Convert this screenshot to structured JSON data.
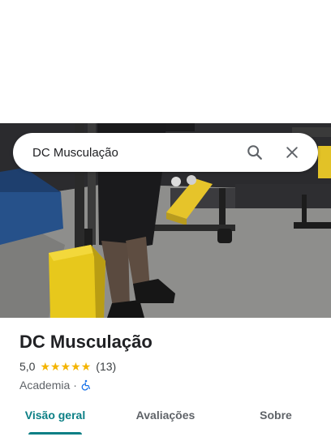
{
  "search": {
    "query": "DC Musculação",
    "search_icon": "search-icon",
    "close_icon": "close-icon"
  },
  "place": {
    "name": "DC Musculação",
    "rating": "5,0",
    "stars": 5,
    "reviews_count": "(13)",
    "category": "Academia",
    "separator": "·",
    "accessibility_icon": "wheelchair-icon"
  },
  "tabs": [
    {
      "label": "Visão geral",
      "active": true
    },
    {
      "label": "Avaliações",
      "active": false
    },
    {
      "label": "Sobre",
      "active": false
    }
  ],
  "colors": {
    "accent": "#0b7f85",
    "star": "#f4b400",
    "accessibility": "#1a73e8"
  }
}
